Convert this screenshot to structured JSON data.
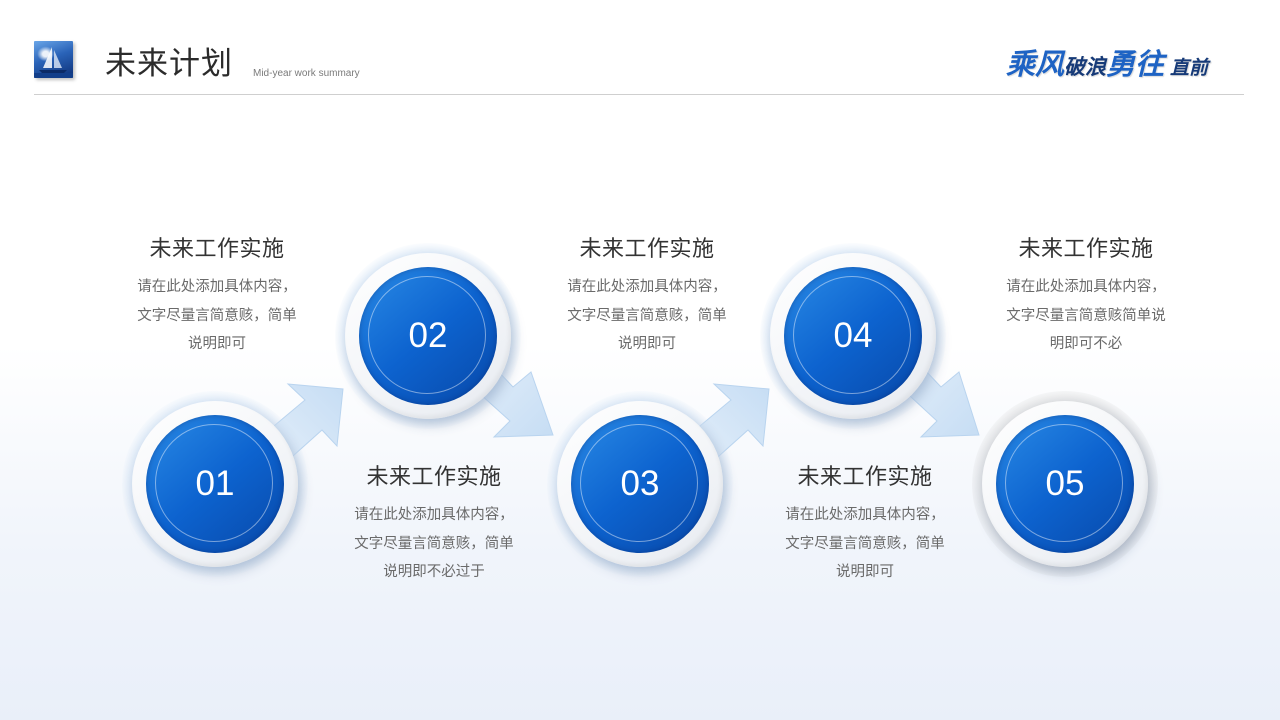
{
  "header": {
    "title": "未来计划",
    "subtitle": "Mid-year work summary",
    "slogan": {
      "part1": "乘风",
      "part2": "破浪",
      "part3": "勇往",
      "part4": "直前"
    }
  },
  "colors": {
    "accent": "#0d63cf",
    "accent_dark": "#0848a8",
    "arrow": "#cfe3f6",
    "title_text": "#333333",
    "desc_text": "#6a6a6a"
  },
  "steps": [
    {
      "number": "01",
      "title": "未来工作实施",
      "desc_lines": [
        "请在此处添加具体内容，",
        "文字尽量言简意赅，简单",
        "说明即可"
      ]
    },
    {
      "number": "02",
      "title": "未来工作实施",
      "desc_lines": [
        "请在此处添加具体内容，",
        "文字尽量言简意赅，简单",
        "说明即不必过于"
      ]
    },
    {
      "number": "03",
      "title": "未来工作实施",
      "desc_lines": [
        "请在此处添加具体内容，",
        "文字尽量言简意赅，简单",
        "说明即可"
      ]
    },
    {
      "number": "04",
      "title": "未来工作实施",
      "desc_lines": [
        "请在此处添加具体内容，",
        "文字尽量言简意赅，简单",
        "说明即可"
      ]
    },
    {
      "number": "05",
      "title": "未来工作实施",
      "desc_lines": [
        "请在此处添加具体内容，",
        "文字尽量言简意赅简单说",
        "明即可不必"
      ]
    }
  ]
}
